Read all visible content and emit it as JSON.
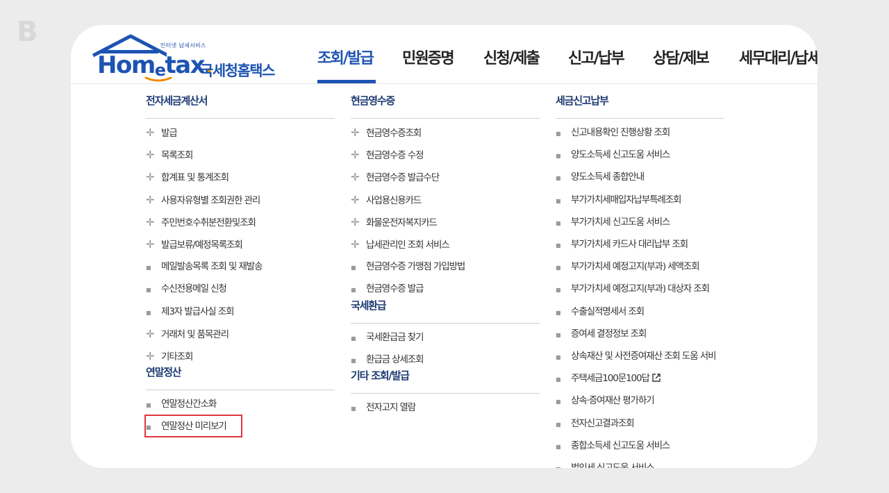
{
  "brand": {
    "tagline": "인터넷 납세서비스",
    "wordmark_a": "Hom",
    "wordmark_e": "e",
    "wordmark_b": "tax",
    "wordmark_dot": ".",
    "korean_name": "국세청홈택스"
  },
  "nav": [
    {
      "label": "조회/발급",
      "active": true
    },
    {
      "label": "민원증명"
    },
    {
      "label": "신청/제출"
    },
    {
      "label": "신고/납부"
    },
    {
      "label": "상담/제보"
    },
    {
      "label": "세무대리/납세"
    }
  ],
  "columns": [
    {
      "sections": [
        {
          "title": "전자세금계산서",
          "items": [
            {
              "label": "발급",
              "marker": "plus"
            },
            {
              "label": "목록조회",
              "marker": "plus"
            },
            {
              "label": "합계표 및 통계조회",
              "marker": "plus"
            },
            {
              "label": "사용자유형별 조회권한 관리",
              "marker": "plus"
            },
            {
              "label": "주민번호수취분전환및조회",
              "marker": "plus"
            },
            {
              "label": "발급보류/예정목록조회",
              "marker": "plus"
            },
            {
              "label": "메일발송목록 조회 및 재발송",
              "marker": "square"
            },
            {
              "label": "수신전용메일 신청",
              "marker": "square"
            },
            {
              "label": "제3자 발급사실 조회",
              "marker": "square"
            },
            {
              "label": "거래처 및 품목관리",
              "marker": "plus"
            },
            {
              "label": "기타조회",
              "marker": "plus"
            }
          ]
        },
        {
          "title": "연말정산",
          "items": [
            {
              "label": "연말정산간소화",
              "marker": "square"
            },
            {
              "label": "연말정산 미리보기",
              "marker": "square",
              "highlighted": true
            }
          ]
        }
      ]
    },
    {
      "sections": [
        {
          "title": "현금영수증",
          "items": [
            {
              "label": "현금영수증조회",
              "marker": "plus"
            },
            {
              "label": "현금영수증 수정",
              "marker": "plus"
            },
            {
              "label": "현금영수증 발급수단",
              "marker": "plus"
            },
            {
              "label": "사업용신용카드",
              "marker": "plus"
            },
            {
              "label": "화물운전자복지카드",
              "marker": "plus"
            },
            {
              "label": "납세관리인 조회 서비스",
              "marker": "plus"
            },
            {
              "label": "현금영수증 가맹점 가입방법",
              "marker": "square"
            },
            {
              "label": "현금영수증 발급",
              "marker": "square"
            }
          ]
        },
        {
          "title": "국세환급",
          "items": [
            {
              "label": "국세환급금 찾기",
              "marker": "square"
            },
            {
              "label": "환급금 상세조회",
              "marker": "square"
            }
          ]
        },
        {
          "title": "기타 조회/발급",
          "items": [
            {
              "label": "전자고지 열람",
              "marker": "square"
            }
          ]
        }
      ]
    },
    {
      "sections": [
        {
          "title": "세금신고납부",
          "items": [
            {
              "label": "신고내용확인 진행상황 조회",
              "marker": "square"
            },
            {
              "label": "양도소득세 신고도움 서비스",
              "marker": "square"
            },
            {
              "label": "양도소득세 종합안내",
              "marker": "square"
            },
            {
              "label": "부가가치세매입자납부특례조회",
              "marker": "square"
            },
            {
              "label": "부가가치세 신고도움 서비스",
              "marker": "square"
            },
            {
              "label": "부가가치세 카드사 대리납부 조회",
              "marker": "square"
            },
            {
              "label": "부가가치세 예정고지(부과) 세액조회",
              "marker": "square"
            },
            {
              "label": "부가가치세 예정고지(부과) 대상자 조회",
              "marker": "square"
            },
            {
              "label": "수출실적명세서 조회",
              "marker": "square"
            },
            {
              "label": "증여세 결정정보 조회",
              "marker": "square"
            },
            {
              "label": "상속재산 및 사전증여재산 조회 도움 서비",
              "marker": "square"
            },
            {
              "label": "주택세금100문100답",
              "marker": "square",
              "external": true
            },
            {
              "label": "상속·증여재산 평가하기",
              "marker": "square"
            },
            {
              "label": "전자신고결과조회",
              "marker": "square"
            },
            {
              "label": "종합소득세 신고도움 서비스",
              "marker": "square"
            },
            {
              "label": "법인세 신고도움 서비스",
              "marker": "square"
            }
          ]
        }
      ]
    }
  ],
  "colors": {
    "brand_blue": "#1d53b3",
    "section_title": "#1d3a72",
    "highlight_border": "#e0353f",
    "background": "#ececec"
  }
}
